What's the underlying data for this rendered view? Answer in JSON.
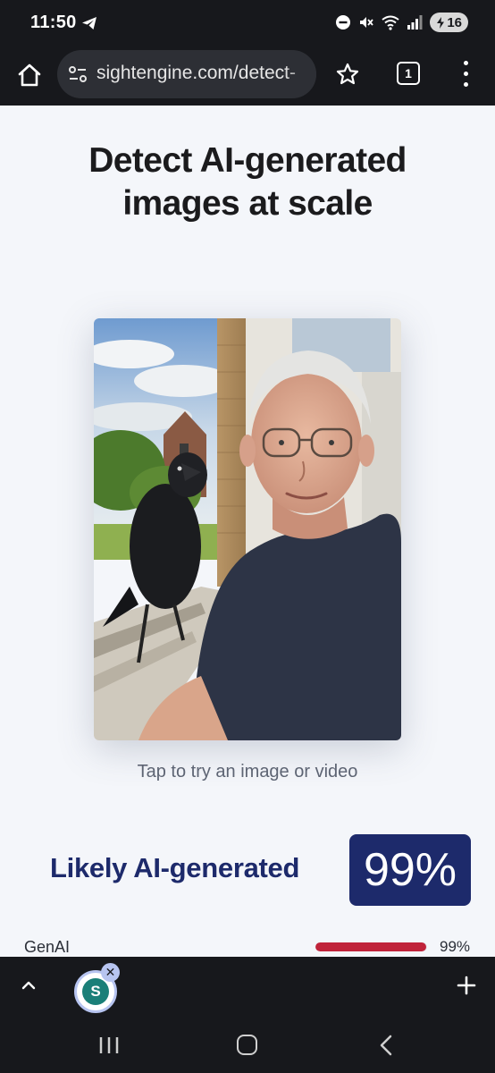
{
  "status_bar": {
    "time": "11:50",
    "battery_level": "16",
    "icons": [
      "telegram-icon",
      "dnd-icon",
      "mute-icon",
      "wifi-icon",
      "signal-icon",
      "battery-icon"
    ]
  },
  "browser": {
    "url": "sightengine.com/detect-",
    "tab_count": "1",
    "icons": [
      "home-icon",
      "site-settings-icon",
      "star-icon",
      "tabs-icon",
      "menu-icon"
    ]
  },
  "page": {
    "hero_title_line1": "Detect AI-generated",
    "hero_title_line2": "images at scale",
    "hint": "Tap to try an image or video",
    "verdict": "Likely AI-generated",
    "score": "99%",
    "genai": {
      "label": "GenAI",
      "value": "99%",
      "fraction": 0.99
    }
  },
  "bottom_bar": {
    "site_chip_letter": "S",
    "icons": [
      "chevron-up-icon",
      "close-icon",
      "plus-icon"
    ]
  },
  "nav_bar": {
    "icons": [
      "recents-icon",
      "home-nav-icon",
      "back-icon"
    ]
  },
  "colors": {
    "system_bar": "#17181c",
    "page_bg": "#f4f6fa",
    "accent_navy": "#1d2a6b",
    "bar_red": "#c0233a"
  }
}
